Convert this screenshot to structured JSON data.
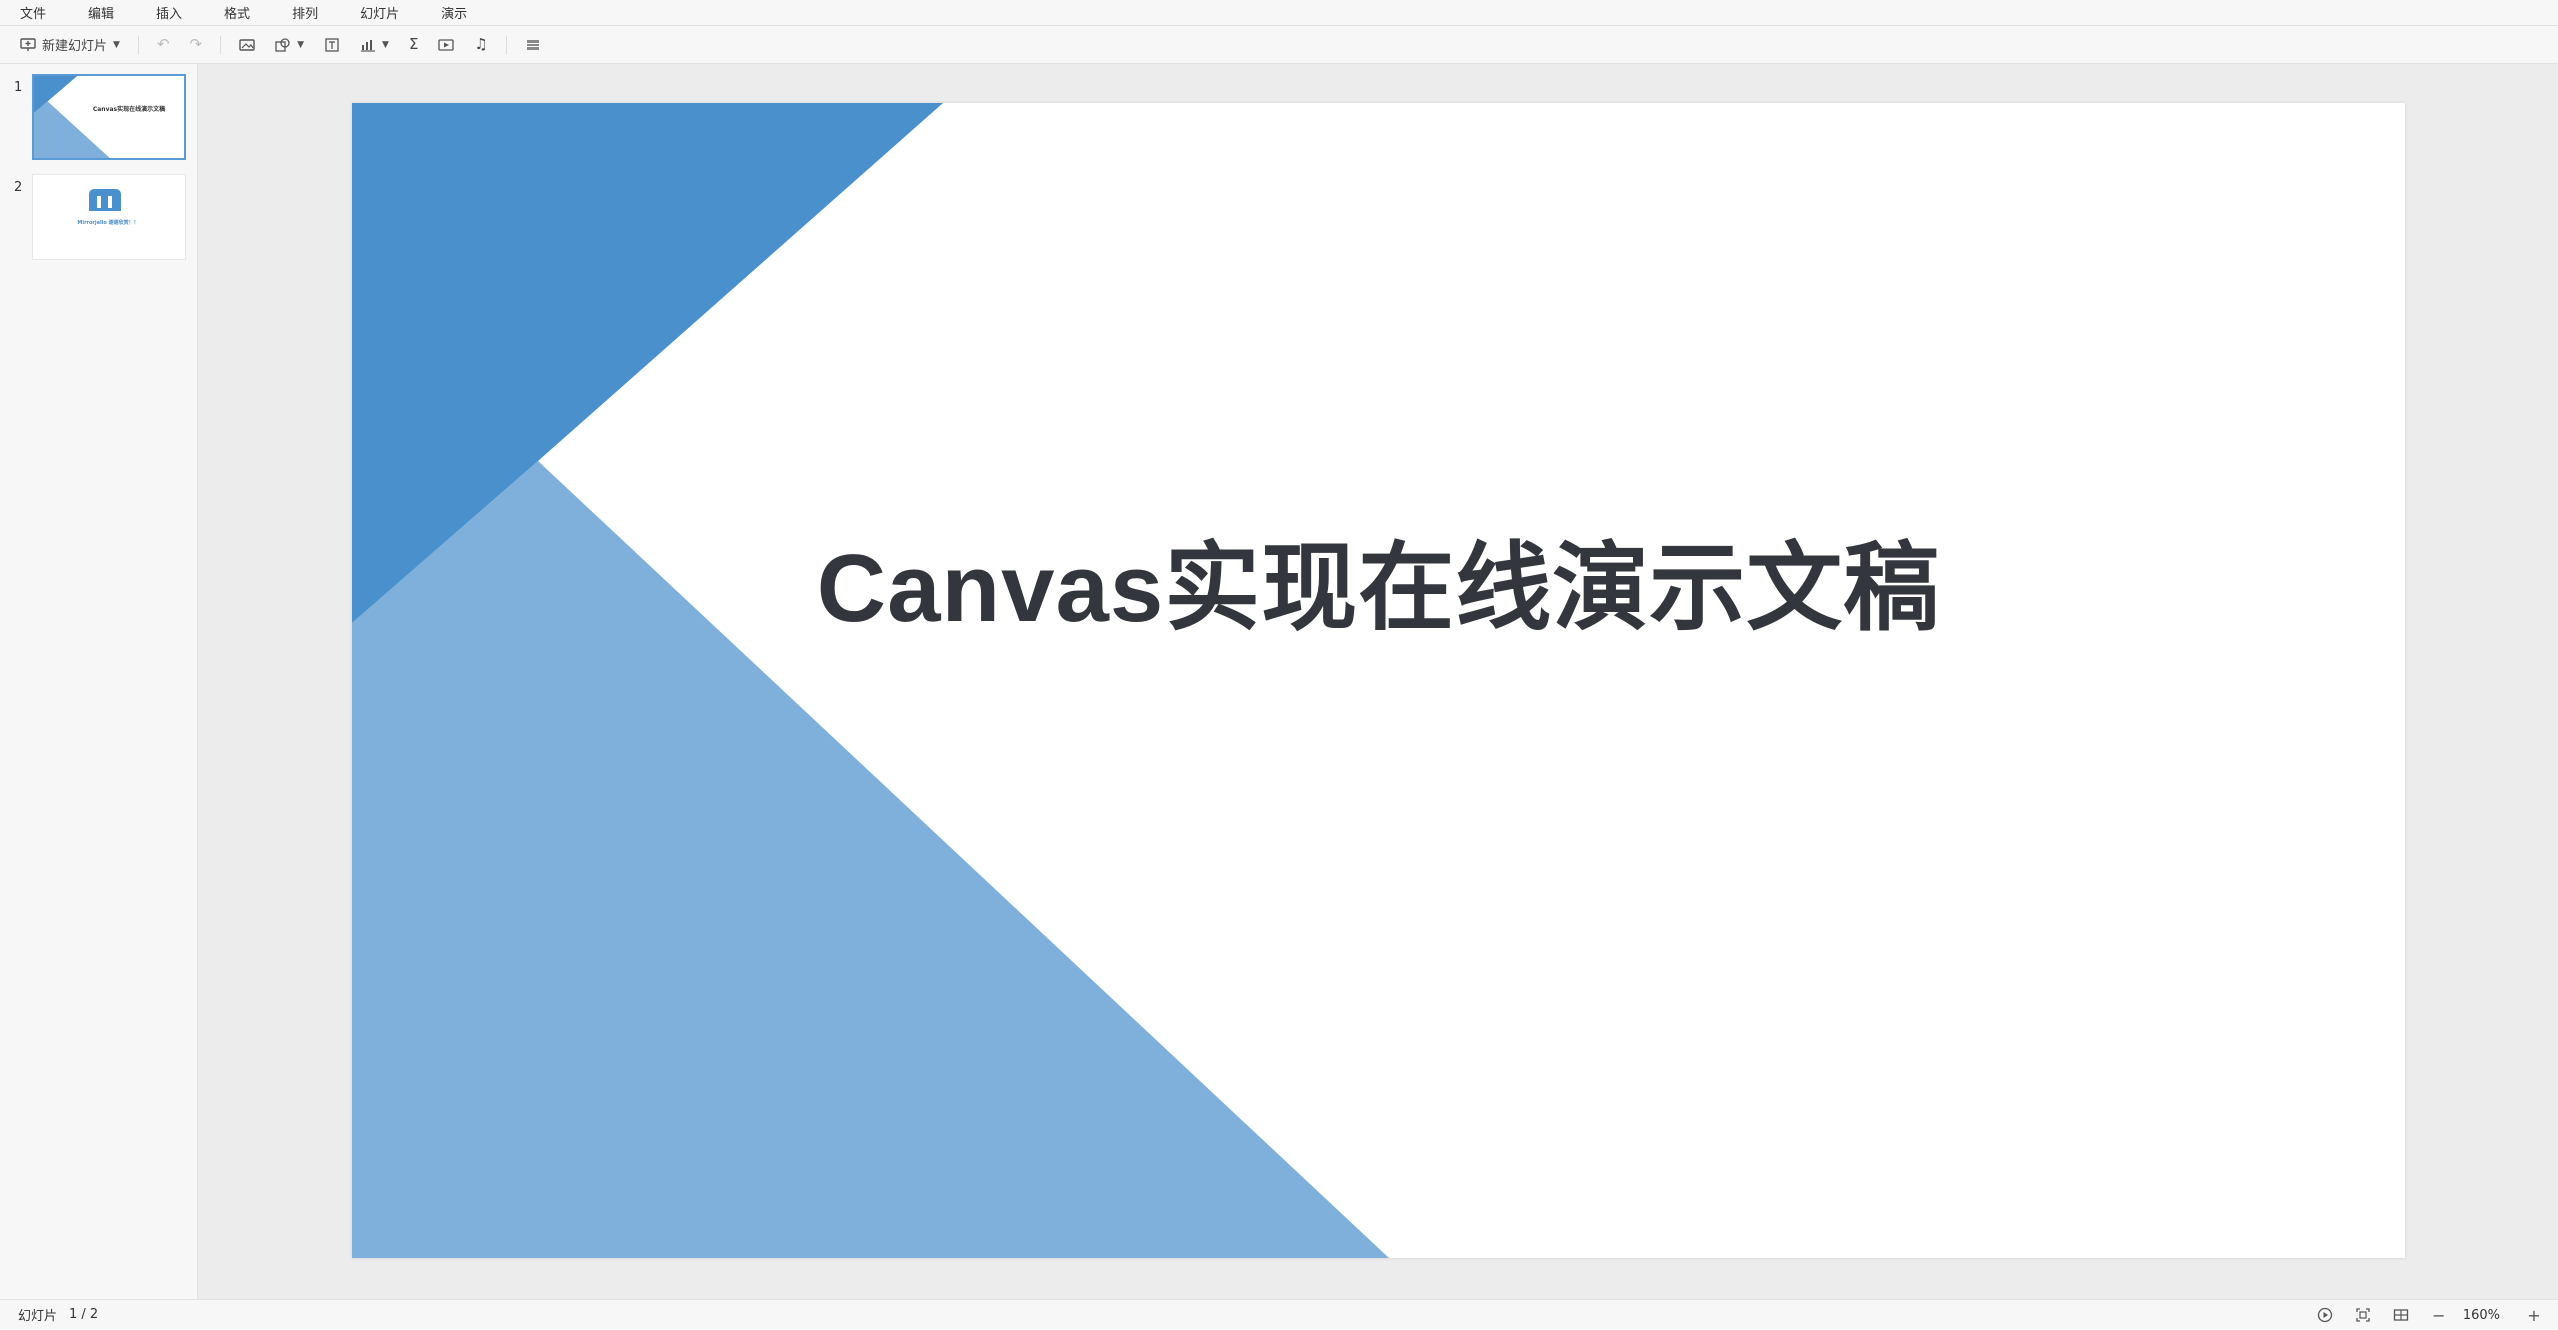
{
  "menubar": {
    "items": [
      "文件",
      "编辑",
      "插入",
      "格式",
      "排列",
      "幻灯片",
      "演示"
    ]
  },
  "toolbar": {
    "new_slide_label": "新建幻灯片",
    "icons": [
      "new-slide-icon",
      "undo-icon",
      "redo-icon",
      "image-icon",
      "shape-icon",
      "text-box-icon",
      "chart-icon",
      "formula-icon",
      "video-icon",
      "audio-icon",
      "table-icon"
    ]
  },
  "thumbnails": [
    {
      "number": "1",
      "title": "Canvas实现在线演示文稿",
      "active": true
    },
    {
      "number": "2",
      "logo_text": "Mirrorjello",
      "title": "Mirrorjello 谢谢欣赏！！"
    }
  ],
  "slide": {
    "title": "Canvas实现在线演示文稿",
    "colors": {
      "dark_blue": "#4a90cc",
      "light_blue": "#7eb0db",
      "title": "#33363c"
    }
  },
  "statusbar": {
    "slide_label": "幻灯片",
    "slide_counter": "1 / 2",
    "zoom": "160%"
  }
}
